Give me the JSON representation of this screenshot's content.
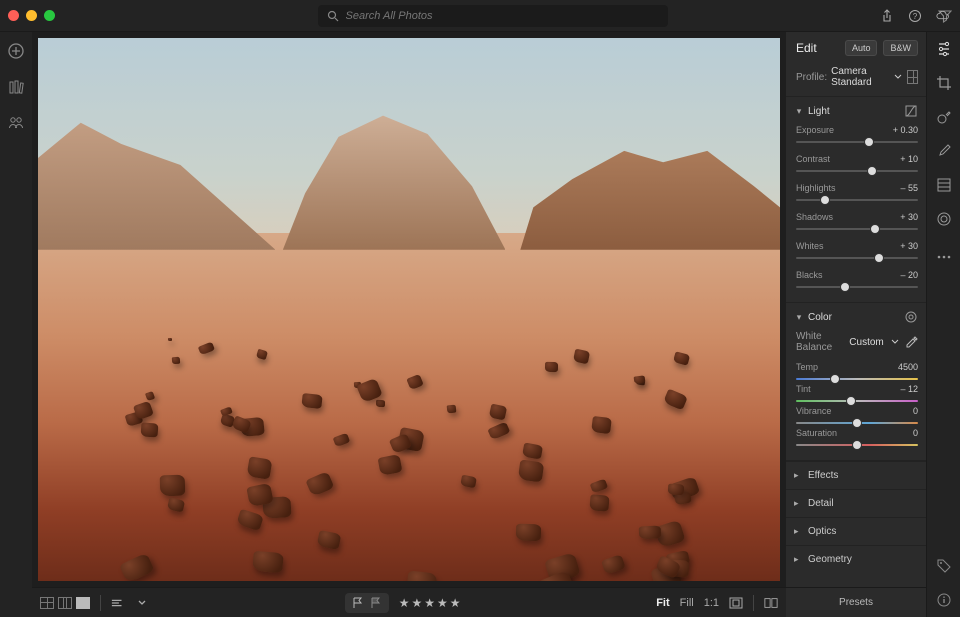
{
  "search": {
    "placeholder": "Search All Photos"
  },
  "edit": {
    "title": "Edit",
    "auto": "Auto",
    "bw": "B&W",
    "profile_label": "Profile:",
    "profile_value": "Camera Standard",
    "presets": "Presets"
  },
  "light": {
    "title": "Light",
    "exposure": {
      "label": "Exposure",
      "value": "+ 0.30",
      "pos": 60
    },
    "contrast": {
      "label": "Contrast",
      "value": "+ 10",
      "pos": 62
    },
    "highlights": {
      "label": "Highlights",
      "value": "– 55",
      "pos": 24
    },
    "shadows": {
      "label": "Shadows",
      "value": "+ 30",
      "pos": 65
    },
    "whites": {
      "label": "Whites",
      "value": "+ 30",
      "pos": 68
    },
    "blacks": {
      "label": "Blacks",
      "value": "– 20",
      "pos": 40
    }
  },
  "color": {
    "title": "Color",
    "wb_label": "White Balance",
    "wb_value": "Custom",
    "temp": {
      "label": "Temp",
      "value": "4500",
      "pos": 32
    },
    "tint": {
      "label": "Tint",
      "value": "– 12",
      "pos": 45
    },
    "vibrance": {
      "label": "Vibrance",
      "value": "0",
      "pos": 50
    },
    "saturation": {
      "label": "Saturation",
      "value": "0",
      "pos": 50
    }
  },
  "sections": {
    "effects": "Effects",
    "detail": "Detail",
    "optics": "Optics",
    "geometry": "Geometry"
  },
  "footer": {
    "fit": "Fit",
    "fill": "Fill",
    "one": "1:1"
  }
}
